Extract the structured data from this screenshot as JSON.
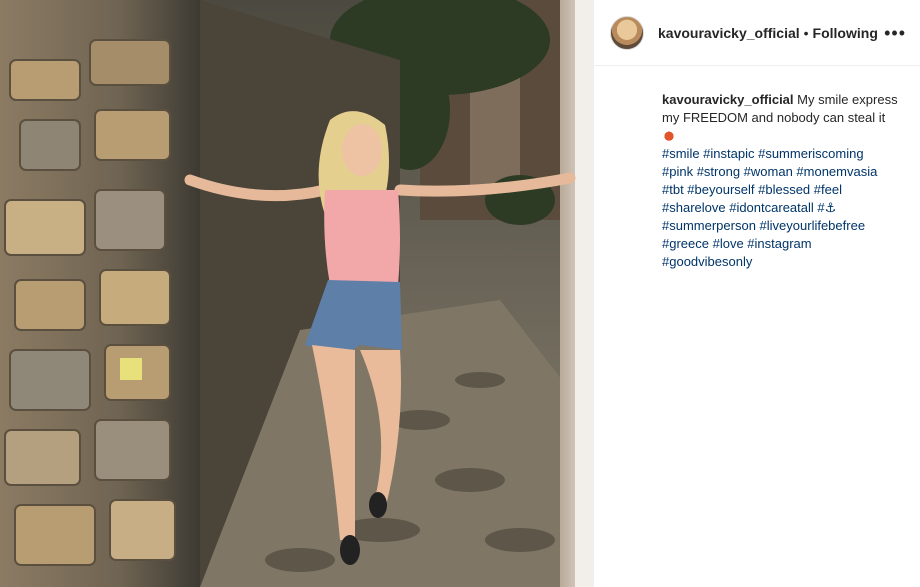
{
  "post": {
    "header": {
      "username": "kavouravicky_official",
      "separator": "•",
      "follow_status": "Following",
      "more_icon": "more-horizontal-icon",
      "more_label": "•••"
    },
    "caption": {
      "username": "kavouravicky_official",
      "text": "My smile express my FREEDOM and nobody can steal it",
      "emoji": "crab-emoji",
      "hashtags_line_1": "#smile #instapic #summeriscoming",
      "hashtags_line_2": "#pink #strong #woman #monemvasia",
      "hashtags_line_3": "#tbt #beyourself #blessed #feel",
      "hashtags_line_4": "#sharelove #idontcareatall #",
      "hashtags_line_4_emoji": "⚓",
      "hashtags_line_5": "#summerperson #liveyourlifebefree",
      "hashtags_line_6": "#greece #love #instagram",
      "hashtags_line_7": "#goodvibesonly"
    },
    "colors": {
      "text": "#262626",
      "hashtag": "#003569",
      "divider": "#efefef"
    }
  }
}
